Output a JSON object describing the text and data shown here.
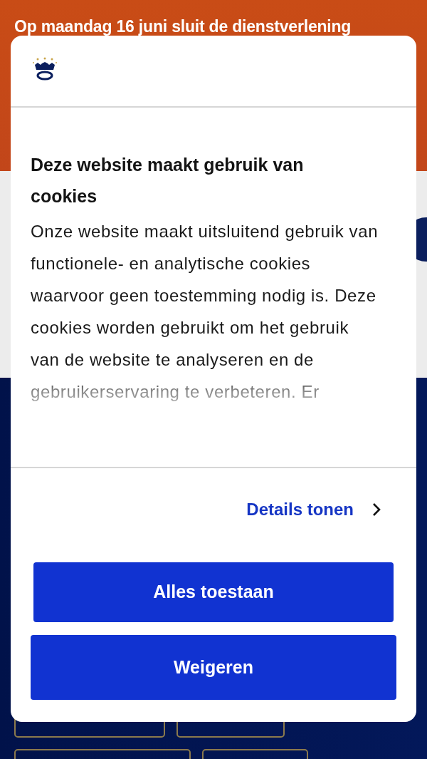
{
  "banner": {
    "text": "Op maandag 16 juni sluit de dienstverlening"
  },
  "dialog": {
    "title": "Deze website maakt gebruik van cookies",
    "body": "Onze website maakt uitsluitend gebruik van functionele- en analytische cookies waarvoor geen toestemming nodig is. Deze cookies worden gebruikt om het gebruik van de website te analyseren en de gebruikerservaring te verbeteren. Er",
    "details_link": "Details tonen",
    "buttons": [
      {
        "label": "Alles toestaan",
        "kind": "accept"
      },
      {
        "label": "Weigeren",
        "kind": "decline"
      }
    ]
  }
}
